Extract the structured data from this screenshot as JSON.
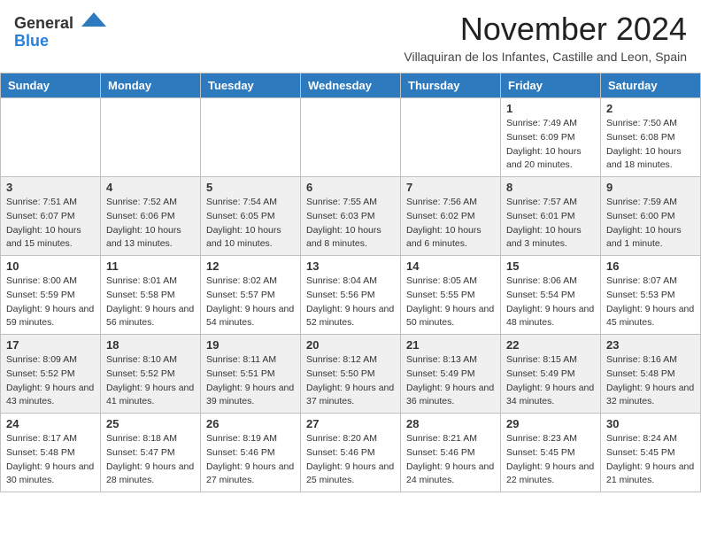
{
  "header": {
    "logo_general": "General",
    "logo_blue": "Blue",
    "month": "November 2024",
    "location": "Villaquiran de los Infantes, Castille and Leon, Spain"
  },
  "weekdays": [
    "Sunday",
    "Monday",
    "Tuesday",
    "Wednesday",
    "Thursday",
    "Friday",
    "Saturday"
  ],
  "weeks": [
    [
      {
        "day": "",
        "info": ""
      },
      {
        "day": "",
        "info": ""
      },
      {
        "day": "",
        "info": ""
      },
      {
        "day": "",
        "info": ""
      },
      {
        "day": "",
        "info": ""
      },
      {
        "day": "1",
        "info": "Sunrise: 7:49 AM\nSunset: 6:09 PM\nDaylight: 10 hours and 20 minutes."
      },
      {
        "day": "2",
        "info": "Sunrise: 7:50 AM\nSunset: 6:08 PM\nDaylight: 10 hours and 18 minutes."
      }
    ],
    [
      {
        "day": "3",
        "info": "Sunrise: 7:51 AM\nSunset: 6:07 PM\nDaylight: 10 hours and 15 minutes."
      },
      {
        "day": "4",
        "info": "Sunrise: 7:52 AM\nSunset: 6:06 PM\nDaylight: 10 hours and 13 minutes."
      },
      {
        "day": "5",
        "info": "Sunrise: 7:54 AM\nSunset: 6:05 PM\nDaylight: 10 hours and 10 minutes."
      },
      {
        "day": "6",
        "info": "Sunrise: 7:55 AM\nSunset: 6:03 PM\nDaylight: 10 hours and 8 minutes."
      },
      {
        "day": "7",
        "info": "Sunrise: 7:56 AM\nSunset: 6:02 PM\nDaylight: 10 hours and 6 minutes."
      },
      {
        "day": "8",
        "info": "Sunrise: 7:57 AM\nSunset: 6:01 PM\nDaylight: 10 hours and 3 minutes."
      },
      {
        "day": "9",
        "info": "Sunrise: 7:59 AM\nSunset: 6:00 PM\nDaylight: 10 hours and 1 minute."
      }
    ],
    [
      {
        "day": "10",
        "info": "Sunrise: 8:00 AM\nSunset: 5:59 PM\nDaylight: 9 hours and 59 minutes."
      },
      {
        "day": "11",
        "info": "Sunrise: 8:01 AM\nSunset: 5:58 PM\nDaylight: 9 hours and 56 minutes."
      },
      {
        "day": "12",
        "info": "Sunrise: 8:02 AM\nSunset: 5:57 PM\nDaylight: 9 hours and 54 minutes."
      },
      {
        "day": "13",
        "info": "Sunrise: 8:04 AM\nSunset: 5:56 PM\nDaylight: 9 hours and 52 minutes."
      },
      {
        "day": "14",
        "info": "Sunrise: 8:05 AM\nSunset: 5:55 PM\nDaylight: 9 hours and 50 minutes."
      },
      {
        "day": "15",
        "info": "Sunrise: 8:06 AM\nSunset: 5:54 PM\nDaylight: 9 hours and 48 minutes."
      },
      {
        "day": "16",
        "info": "Sunrise: 8:07 AM\nSunset: 5:53 PM\nDaylight: 9 hours and 45 minutes."
      }
    ],
    [
      {
        "day": "17",
        "info": "Sunrise: 8:09 AM\nSunset: 5:52 PM\nDaylight: 9 hours and 43 minutes."
      },
      {
        "day": "18",
        "info": "Sunrise: 8:10 AM\nSunset: 5:52 PM\nDaylight: 9 hours and 41 minutes."
      },
      {
        "day": "19",
        "info": "Sunrise: 8:11 AM\nSunset: 5:51 PM\nDaylight: 9 hours and 39 minutes."
      },
      {
        "day": "20",
        "info": "Sunrise: 8:12 AM\nSunset: 5:50 PM\nDaylight: 9 hours and 37 minutes."
      },
      {
        "day": "21",
        "info": "Sunrise: 8:13 AM\nSunset: 5:49 PM\nDaylight: 9 hours and 36 minutes."
      },
      {
        "day": "22",
        "info": "Sunrise: 8:15 AM\nSunset: 5:49 PM\nDaylight: 9 hours and 34 minutes."
      },
      {
        "day": "23",
        "info": "Sunrise: 8:16 AM\nSunset: 5:48 PM\nDaylight: 9 hours and 32 minutes."
      }
    ],
    [
      {
        "day": "24",
        "info": "Sunrise: 8:17 AM\nSunset: 5:48 PM\nDaylight: 9 hours and 30 minutes."
      },
      {
        "day": "25",
        "info": "Sunrise: 8:18 AM\nSunset: 5:47 PM\nDaylight: 9 hours and 28 minutes."
      },
      {
        "day": "26",
        "info": "Sunrise: 8:19 AM\nSunset: 5:46 PM\nDaylight: 9 hours and 27 minutes."
      },
      {
        "day": "27",
        "info": "Sunrise: 8:20 AM\nSunset: 5:46 PM\nDaylight: 9 hours and 25 minutes."
      },
      {
        "day": "28",
        "info": "Sunrise: 8:21 AM\nSunset: 5:46 PM\nDaylight: 9 hours and 24 minutes."
      },
      {
        "day": "29",
        "info": "Sunrise: 8:23 AM\nSunset: 5:45 PM\nDaylight: 9 hours and 22 minutes."
      },
      {
        "day": "30",
        "info": "Sunrise: 8:24 AM\nSunset: 5:45 PM\nDaylight: 9 hours and 21 minutes."
      }
    ]
  ]
}
